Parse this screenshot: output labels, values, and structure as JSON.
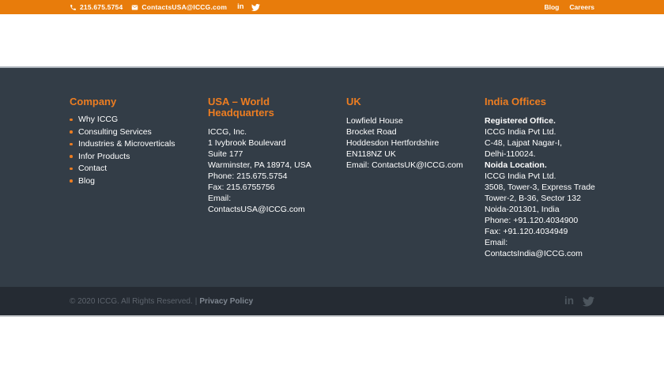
{
  "colors": {
    "topbar_bg": "#e87c0b",
    "accent_orange": "#ed7d21",
    "footer_bg": "#333d47",
    "footer_top_border": "#aeb5bd",
    "bottombar_bg": "#252b33",
    "copyright_text": "#5d646d",
    "privacy_text": "#7f8791",
    "social_icon_gray": "#4d565e",
    "footer_body_text": "#ffffff"
  },
  "icons": {
    "linkedin_text": "in"
  },
  "topbar": {
    "phone": "215.675.5754",
    "email": "ContactsUSA@ICCG.com",
    "nav": {
      "blog": "Blog",
      "careers": "Careers"
    }
  },
  "footer": {
    "company": {
      "heading": "Company",
      "items": [
        "Why ICCG",
        "Consulting Services",
        "Industries & Microverticals",
        "Infor Products",
        "Contact",
        "Blog"
      ]
    },
    "usa": {
      "heading": "USA – World Headquarters",
      "lines": [
        "ICCG, Inc.",
        "1 Ivybrook Boulevard",
        "Suite 177",
        "Warminster, PA 18974, USA",
        "Phone: 215.675.5754",
        "Fax: 215.6755756",
        "Email: ContactsUSA@ICCG.com"
      ]
    },
    "uk": {
      "heading": "UK",
      "lines": [
        "Lowfield House",
        "Brocket Road",
        "Hoddesdon Hertfordshire",
        "EN118NZ UK",
        "Email: ContactsUK@ICCG.com"
      ]
    },
    "india": {
      "heading": "India Offices",
      "lines": [
        "Registered Office.",
        "ICCG India Pvt Ltd.",
        "C-48, Lajpat Nagar-I,",
        "Delhi-110024.",
        "Noida Location.",
        "ICCG India Pvt Ltd.",
        "3508, Tower-3, Express Trade",
        "Tower-2, B-36, Sector 132",
        "Noida-201301, India",
        "Phone: +91.120.4034900",
        "Fax: +91.120.4034949",
        "Email: ContactsIndia@ICCG.com"
      ]
    }
  },
  "bottombar": {
    "copyright": "© 2020 ICCG. All Rights Reserved.",
    "separator": "|",
    "privacy": "Privacy Policy"
  }
}
